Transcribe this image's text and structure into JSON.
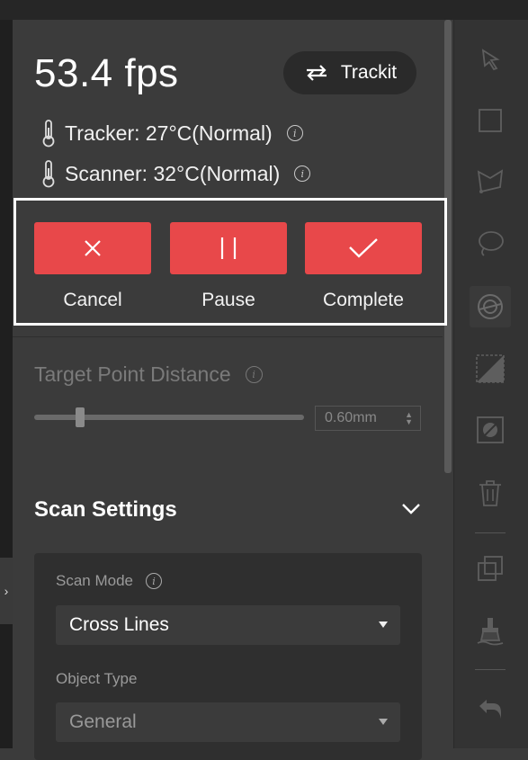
{
  "status": {
    "fps": "53.4 fps",
    "tracker_temp": "Tracker: 27°C(Normal)",
    "scanner_temp": "Scanner: 32°C(Normal)"
  },
  "trackit_button": {
    "label": "Trackit",
    "icon": "swap-arrows-icon"
  },
  "actions": {
    "cancel": {
      "label": "Cancel",
      "icon": "x-icon"
    },
    "pause": {
      "label": "Pause",
      "icon": "pause-icon"
    },
    "complete": {
      "label": "Complete",
      "icon": "check-icon"
    },
    "button_color": "#e8484a"
  },
  "target_point": {
    "label": "Target Point Distance",
    "value": "0.60mm",
    "enabled": false
  },
  "scan_settings": {
    "title": "Scan Settings",
    "expanded": true,
    "scan_mode_label": "Scan Mode",
    "scan_mode_value": "Cross Lines",
    "object_type_label": "Object Type",
    "object_type_value": "General"
  },
  "toolbar": {
    "tools": [
      "select-arrow-icon",
      "rectangle-select-icon",
      "polygon-select-icon",
      "lasso-select-icon",
      "brush-select-icon",
      "invert-select-icon",
      "deselect-icon",
      "delete-icon",
      "copy-icon",
      "clean-icon",
      "undo-icon"
    ]
  },
  "colors": {
    "panel": "#3b3b3b",
    "accent": "#e8484a",
    "toolbar": "#333333"
  }
}
